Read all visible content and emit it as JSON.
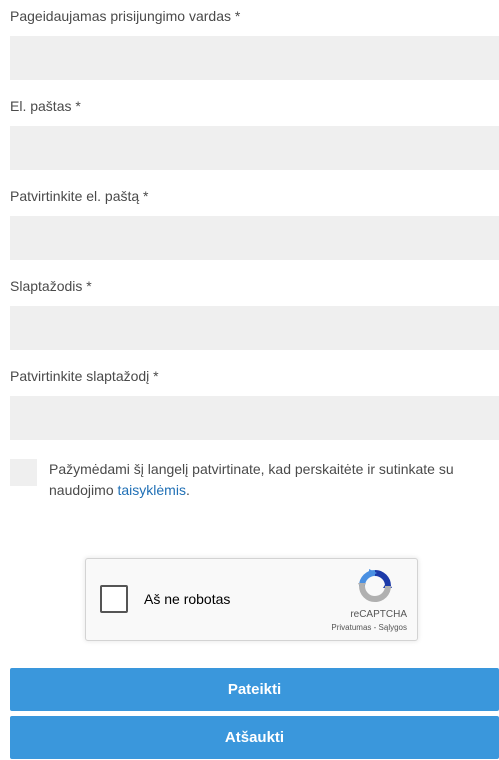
{
  "form": {
    "fields": [
      {
        "label": "Pageidaujamas prisijungimo vardas *",
        "value": "",
        "placeholder": ""
      },
      {
        "label": "El. paštas *",
        "value": "",
        "placeholder": ""
      },
      {
        "label": "Patvirtinkite el. paštą *",
        "value": "",
        "placeholder": ""
      },
      {
        "label": "Slaptažodis *",
        "value": "",
        "placeholder": ""
      },
      {
        "label": "Patvirtinkite slaptažodį *",
        "value": "",
        "placeholder": ""
      }
    ],
    "terms": {
      "text": "Pažymėdami šį langelį patvirtinate, kad perskaitėte ir sutinkate su naudojimo ",
      "link": "taisyklėmis",
      "suffix": ".",
      "checked": false
    }
  },
  "recaptcha": {
    "label": "Aš ne robotas",
    "brand": "reCAPTCHA",
    "privacy": "Privatumas",
    "separator": " - ",
    "terms": "Sąlygos",
    "logo_icon": "recaptcha-logo-icon",
    "colors": {
      "blue": "#1c3aa9",
      "light_blue": "#4a90e2",
      "gray": "#b0b0b0"
    }
  },
  "buttons": {
    "submit": "Pateikti",
    "cancel": "Atšaukti"
  },
  "colors": {
    "input_bg": "#efefef",
    "button_bg": "#3a97dc",
    "link": "#1f6fb5",
    "label_text": "#4a4a4a"
  }
}
